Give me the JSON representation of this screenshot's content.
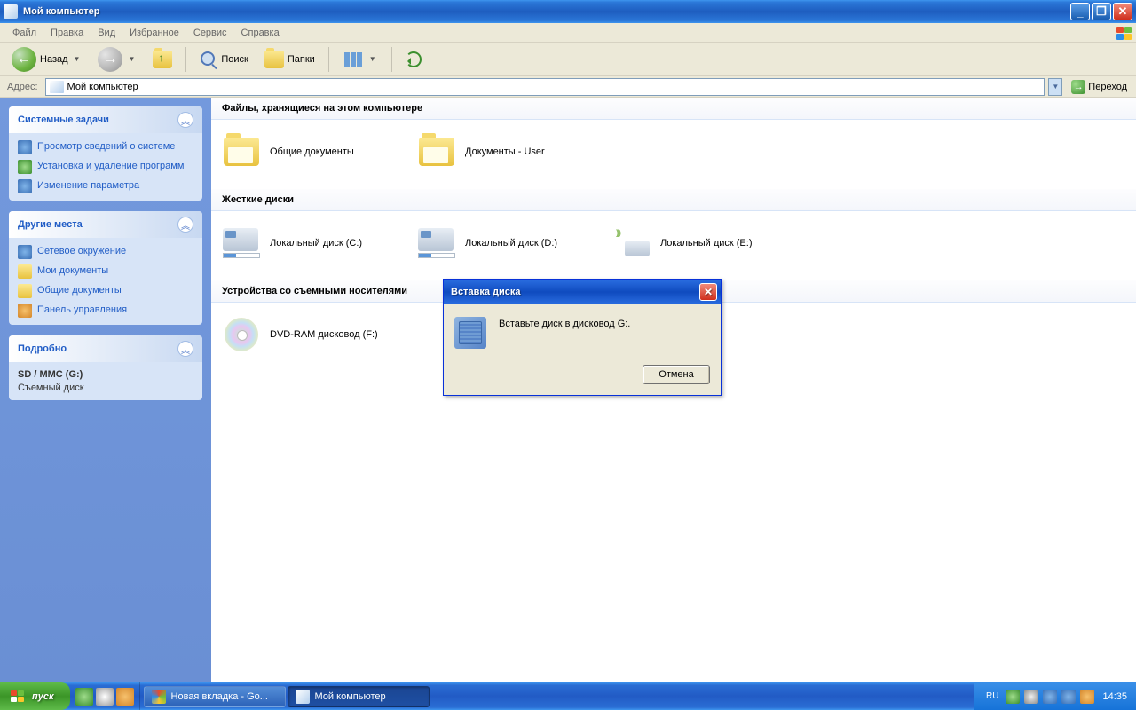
{
  "window": {
    "title": "Мой компьютер"
  },
  "menu": {
    "file": "Файл",
    "edit": "Правка",
    "view": "Вид",
    "favorites": "Избранное",
    "tools": "Сервис",
    "help": "Справка"
  },
  "toolbar": {
    "back": "Назад",
    "search": "Поиск",
    "folders": "Папки"
  },
  "addressbar": {
    "label": "Адрес:",
    "value": "Мой компьютер",
    "go": "Переход"
  },
  "sidebar": {
    "system": {
      "title": "Системные задачи",
      "links": [
        "Просмотр сведений о системе",
        "Установка и удаление программ",
        "Изменение параметра"
      ]
    },
    "places": {
      "title": "Другие места",
      "links": [
        "Сетевое окружение",
        "Мои документы",
        "Общие документы",
        "Панель управления"
      ]
    },
    "details": {
      "title": "Подробно",
      "name": "SD / MMC (G:)",
      "type": "Съемный диск"
    }
  },
  "content": {
    "files_section": "Файлы, хранящиеся на этом компьютере",
    "folders": [
      "Общие документы",
      "Документы - User"
    ],
    "hdd_section": "Жесткие диски",
    "drives": [
      "Локальный диск (C:)",
      "Локальный диск (D:)",
      "Локальный диск (E:)"
    ],
    "removable_section": "Устройства со съемными носителями",
    "removable": [
      "DVD-RAM дисковод (F:)"
    ]
  },
  "dialog": {
    "title": "Вставка диска",
    "message": "Вставьте диск в дисковод G:.",
    "cancel": "Отмена"
  },
  "taskbar": {
    "start": "пуск",
    "tasks": [
      "Новая вкладка - Go...",
      "Мой компьютер"
    ],
    "lang": "RU",
    "clock": "14:35"
  }
}
